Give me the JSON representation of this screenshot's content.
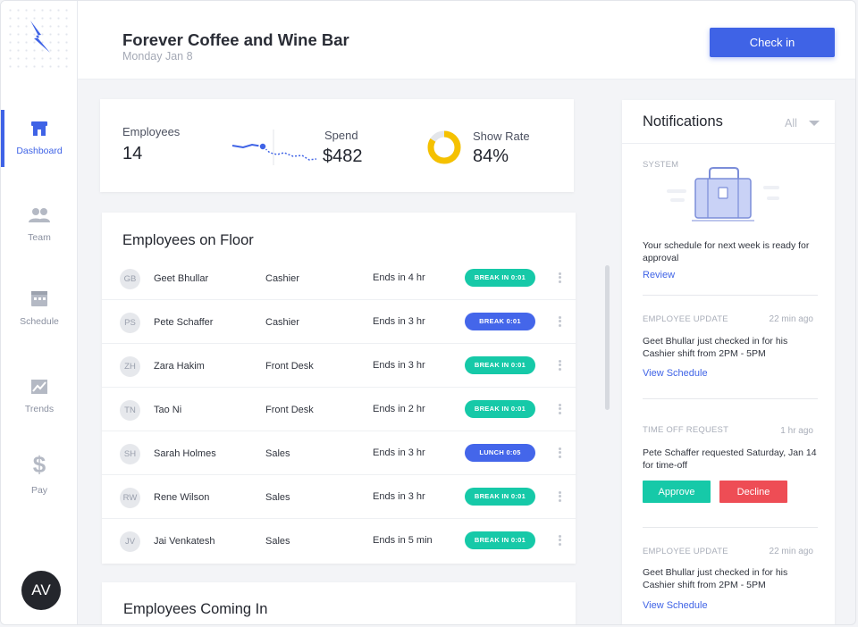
{
  "app": {
    "business_name": "Forever Coffee and Wine Bar",
    "date": "Monday Jan 8",
    "check_in_label": "Check in",
    "accent": "#3f63e6"
  },
  "sidebar": {
    "items": [
      {
        "label": "Dashboard",
        "icon": "store-icon",
        "active": true
      },
      {
        "label": "Team",
        "icon": "people-icon",
        "active": false
      },
      {
        "label": "Schedule",
        "icon": "calendar-icon",
        "active": false
      },
      {
        "label": "Trends",
        "icon": "chart-icon",
        "active": false
      },
      {
        "label": "Pay",
        "icon": "dollar-icon",
        "active": false
      }
    ],
    "avatar_initials": "AV"
  },
  "stats": {
    "employees_label": "Employees",
    "employees_value": "14",
    "spend_label": "Spend",
    "spend_value": "$482",
    "show_rate_label": "Show Rate",
    "show_rate_value": "84%",
    "show_rate_fraction": 0.84,
    "donut_color": "#f5c100"
  },
  "floor": {
    "title": "Employees on Floor",
    "employees": [
      {
        "initials": "GB",
        "name": "Geet Bhullar",
        "role": "Cashier",
        "ends": "Ends in 4 hr",
        "status": "BREAK IN  0:01",
        "color": "green"
      },
      {
        "initials": "PS",
        "name": "Pete Schaffer",
        "role": "Cashier",
        "ends": "Ends in 3 hr",
        "status": "BREAK  0:01",
        "color": "blue"
      },
      {
        "initials": "ZH",
        "name": "Zara Hakim",
        "role": "Front Desk",
        "ends": "Ends in 3 hr",
        "status": "BREAK IN  0:01",
        "color": "green"
      },
      {
        "initials": "TN",
        "name": "Tao Ni",
        "role": "Front Desk",
        "ends": "Ends in 2 hr",
        "status": "BREAK IN  0:01",
        "color": "green"
      },
      {
        "initials": "SH",
        "name": "Sarah Holmes",
        "role": "Sales",
        "ends": "Ends in 3 hr",
        "status": "LUNCH  0:05",
        "color": "blue"
      },
      {
        "initials": "RW",
        "name": "Rene Wilson",
        "role": "Sales",
        "ends": "Ends in 3 hr",
        "status": "BREAK IN  0:01",
        "color": "green"
      },
      {
        "initials": "JV",
        "name": "Jai Venkatesh",
        "role": "Sales",
        "ends": "Ends in 5 min",
        "status": "BREAK IN  0:01",
        "color": "green"
      }
    ]
  },
  "coming": {
    "title": "Employees Coming In"
  },
  "notifications": {
    "title": "Notifications",
    "filter": "All",
    "items": [
      {
        "type": "SYSTEM",
        "time": "",
        "text": "Your schedule for next week is ready for approval",
        "link": "Review"
      },
      {
        "type": "EMPLOYEE UPDATE",
        "time": "22 min ago",
        "text": "Geet Bhullar just checked in for his Cashier shift from 2PM - 5PM",
        "link": "View Schedule"
      },
      {
        "type": "TIME OFF REQUEST",
        "time": "1 hr ago",
        "text": "Pete Schaffer requested Saturday, Jan 14 for time-off",
        "approve": "Approve",
        "decline": "Decline"
      },
      {
        "type": "EMPLOYEE UPDATE",
        "time": "22 min ago",
        "text": "Geet Bhullar just checked in for his Cashier shift from 2PM - 5PM",
        "link": "View Schedule"
      }
    ]
  }
}
